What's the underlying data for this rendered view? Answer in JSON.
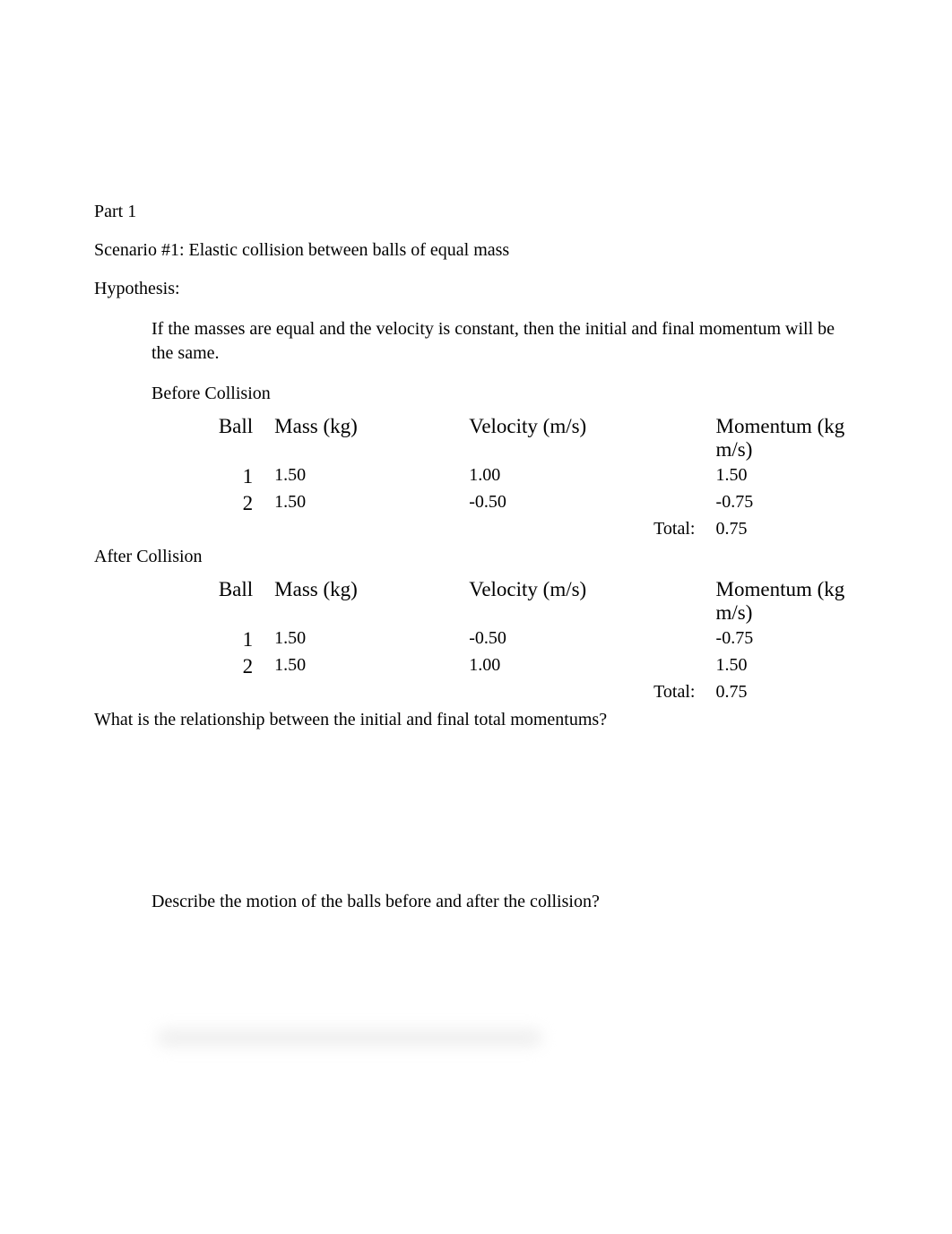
{
  "part": "Part 1",
  "scenario": "Scenario #1: Elastic collision between balls of equal mass",
  "hypothesis_label": "Hypothesis:",
  "hypothesis_text": " If the masses are equal and the velocity is constant, then the initial and final momentum will be the same.",
  "before_title": " Before Collision",
  "after_title": "After Collision",
  "headers": {
    "ball": "Ball",
    "mass": "Mass (kg)",
    "velocity": "Velocity (m/s)",
    "momentum": "Momentum (kg m/s)"
  },
  "total_label": "Total:",
  "before": {
    "rows": [
      {
        "ball": "1",
        "mass": "1.50",
        "velocity": "1.00",
        "momentum": "1.50"
      },
      {
        "ball": "2",
        "mass": "1.50",
        "velocity": "-0.50",
        "momentum": "-0.75"
      }
    ],
    "total": "0.75"
  },
  "after": {
    "rows": [
      {
        "ball": "1",
        "mass": "1.50",
        "velocity": "-0.50",
        "momentum": "-0.75"
      },
      {
        "ball": "2",
        "mass": "1.50",
        "velocity": "1.00",
        "momentum": "1.50"
      }
    ],
    "total": "0.75"
  },
  "question1": "What is the relationship between the initial and final total momentums?",
  "question2": " Describe the motion of the balls before and after the collision?",
  "chart_data": {
    "type": "table",
    "title": "Elastic collision between balls of equal mass",
    "tables": [
      {
        "name": "Before Collision",
        "columns": [
          "Ball",
          "Mass (kg)",
          "Velocity (m/s)",
          "Momentum (kg m/s)"
        ],
        "rows": [
          [
            1,
            1.5,
            1.0,
            1.5
          ],
          [
            2,
            1.5,
            -0.5,
            -0.75
          ]
        ],
        "total_momentum": 0.75
      },
      {
        "name": "After Collision",
        "columns": [
          "Ball",
          "Mass (kg)",
          "Velocity (m/s)",
          "Momentum (kg m/s)"
        ],
        "rows": [
          [
            1,
            1.5,
            -0.5,
            -0.75
          ],
          [
            2,
            1.5,
            1.0,
            1.5
          ]
        ],
        "total_momentum": 0.75
      }
    ]
  }
}
